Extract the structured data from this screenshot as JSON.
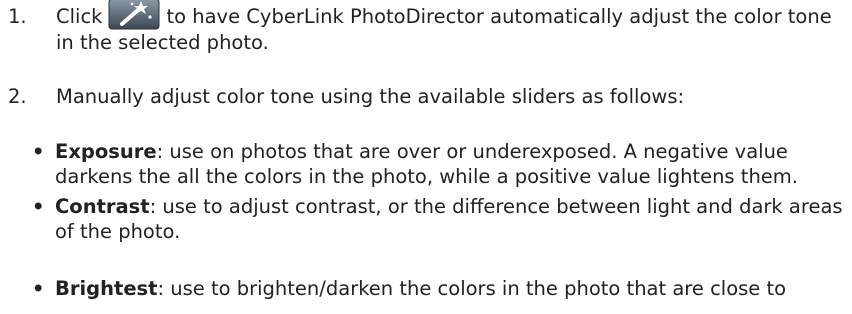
{
  "steps": [
    {
      "number": "1.",
      "before_icon": "Click",
      "icon": "auto-adjust-wand-icon",
      "after_icon": "to have CyberLink PhotoDirector automatically adjust the color tone in the selected photo."
    },
    {
      "number": "2.",
      "text": "Manually adjust color tone using the available sliders as follows:"
    }
  ],
  "bullets": [
    {
      "marker": "•",
      "term": "Exposure",
      "text": ": use on photos that are over or underexposed. A negative value darkens the all the colors in the photo, while a positive value lightens them."
    },
    {
      "marker": "•",
      "term": "Contrast",
      "text": ": use to adjust contrast, or the difference between light and dark areas of the photo."
    },
    {
      "marker": "•",
      "term": "Brightest",
      "text": ": use to brighten/darken the colors in the photo that are close to"
    }
  ],
  "colors": {
    "text": "#222222",
    "icon_bg_top": "#7a8a99",
    "icon_bg_bottom": "#3f4a55"
  }
}
